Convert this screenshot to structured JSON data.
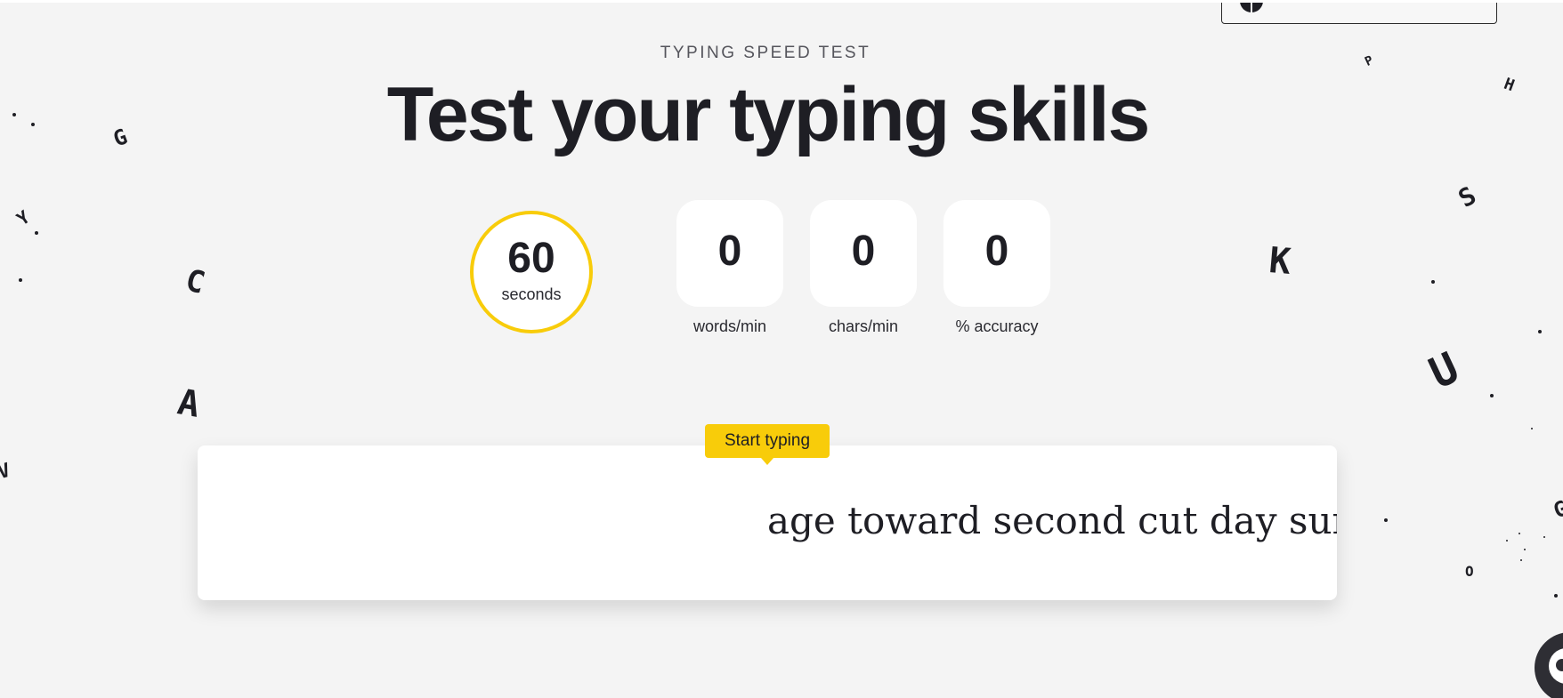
{
  "header": {
    "kicker": "TYPING SPEED TEST",
    "title": "Test your typing skills"
  },
  "timer": {
    "value": "60",
    "unit": "seconds"
  },
  "stats": [
    {
      "value": "0",
      "label": "words/min"
    },
    {
      "value": "0",
      "label": "chars/min"
    },
    {
      "value": "0",
      "label": "% accuracy"
    }
  ],
  "typing": {
    "tooltip": "Start typing",
    "text": "age toward second cut day surface"
  },
  "decor_letters": [
    "G",
    "Y",
    "C",
    "A",
    "V",
    "P",
    "H",
    "S",
    "K",
    "U",
    "G",
    "O"
  ],
  "colors": {
    "accent": "#f8cc0a",
    "background": "#f4f4f4",
    "ink": "#1e1e24"
  },
  "icons": {
    "chat": "chat-bubble-icon",
    "top_widget": "language-globe-icon"
  }
}
